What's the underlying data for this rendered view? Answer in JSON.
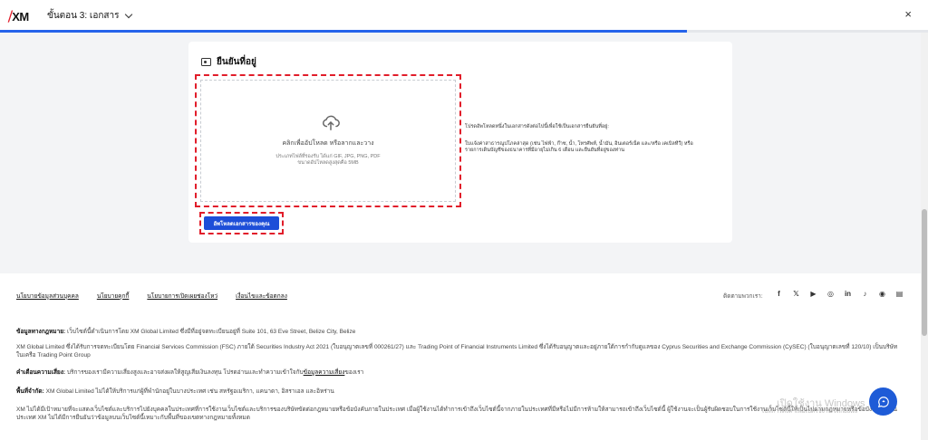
{
  "header": {
    "logo_text": "XM",
    "step_title": "ขั้นตอน 3: เอกสาร",
    "close_label": "×",
    "progress_percent": 74
  },
  "card": {
    "title": "ยืนยันที่อยู่",
    "dropzone": {
      "main_text": "คลิกเพื่ออัปโหลด หรือลากและวาง",
      "sub_line1": "ประเภทไฟล์ที่รองรับ ได้แก่ GIF, JPG, PNG, PDF",
      "sub_line2": "ขนาดอัปโหลดสูงสุดคือ 5MB"
    },
    "instructions": [
      "โปรดอัพโหลดหนึ่งในเอกสารดังต่อไปนี้เพื่อใช้เป็นเอกสารยืนยันที่อยู่:",
      "ใบแจ้งค่าสาธารณูปโภคล่าสุด (เช่น ไฟฟ้า, ก๊าซ, น้ำ, โทรศัพท์, น้ำมัน, อินเตอร์เน็ต และ/หรือ เคเบิลทีวี) หรือรายการเดินบัญชีของธนาคารที่มีอายุไม่เกิน 6 เดือน และยืนยันที่อยู่ของท่าน"
    ],
    "upload_button": "อัพโหลดเอกสารของคุณ"
  },
  "footer": {
    "links": [
      "นโยบายข้อมูลส่วนบุคคล",
      "นโยบายคุกกี้",
      "นโยบายการเปิดเผยช่องโหว่",
      "เงื่อนไขและข้อตกลง"
    ],
    "follow_label": "ติดตามพวกเรา:",
    "social_icons": [
      "facebook-icon",
      "x-icon",
      "youtube-icon",
      "instagram-icon",
      "linkedin-icon",
      "tiktok-icon",
      "line-icon",
      "news-icon"
    ],
    "legal_heading": "ข้อมูลทางกฎหมาย:",
    "legal_text": "เว็บไซต์นี้ดำเนินการโดย XM Global Limited ซึ่งมีที่อยู่จดทะเบียนอยู่ที่ Suite 101, 63 Eve Street, Belize City, Belize",
    "regulation_text": "XM Global Limited ซึ่งได้รับการจดทะเบียนโดย Financial Services Commission (FSC) ภายใต้ Securities Industry Act 2021 (ใบอนุญาตเลขที่ 000261/27) และ Trading Point of Financial Instruments Limited ซึ่งได้รับอนุญาตและอยู่ภายใต้การกำกับดูแลของ Cyprus Securities and Exchange Commission (CySEC) (ใบอนุญาตเลขที่ 120/10) เป็นบริษัทในเครือ Trading Point Group",
    "risk_heading": "คำเตือนความเสี่ยง:",
    "risk_text": "บริการของเรามีความเสี่ยงสูงและอาจส่งผลให้สูญเสียเงินลงทุน โปรดอ่านและทำความเข้าใจกับ",
    "risk_link": "ข้อมูลความเสี่ยง",
    "risk_tail": "ของเรา",
    "restrict_heading": "พื้นที่จำกัด:",
    "restrict_text": "XM Global Limited ไม่ได้ให้บริการแก่ผู้ที่พำนักอยู่ในบางประเทศ เช่น สหรัฐอเมริกา, แคนาดา, อิสราเอล และอิหร่าน",
    "disclaimer_text": "XM ไม่ได้มีเป้าหมายที่จะแสดงเว็บไซต์และบริการไปยังบุคคลในประเทศที่การใช้งานเว็บไซต์และบริการของบริษัทขัดต่อกฎหมายหรือข้อบังคับภายในประเทศ เมื่อผู้ใช้งานได้ทำการเข้าถึงเว็บไซต์นี้จากภายในประเทศที่มีหรือไม่มีการห้ามให้สามารถเข้าถึงเว็บไซต์นี้ ผู้ใช้งานจะเป็นผู้รับผิดชอบในการใช้งานเว็บไซต์นี้ให้เป็นไปตามกฎหมายหรือข้อบังคับภายในประเทศ XM ไม่ได้มีการยืนยันว่าข้อมูลบนเว็บไซต์นี้เหมาะกับพื้นที่ของเขตทางกฎหมายทั้งหมด"
  },
  "watermark": {
    "line1": "เปิดใช้งาน Windows",
    "line2": "ไปที่การตั้งค่าเพื่อเปิดใช้งาน Windows"
  }
}
